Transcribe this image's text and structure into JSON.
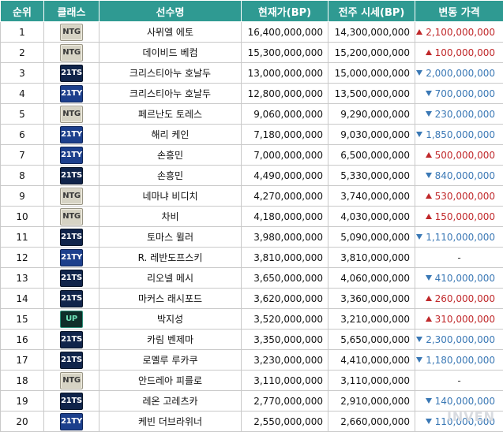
{
  "columns": [
    "순위",
    "클래스",
    "선수명",
    "현재가(BP)",
    "전주 시세(BP)",
    "변동 가격"
  ],
  "rows": [
    {
      "rank": "1",
      "class": "NTG",
      "name": "사뮈엘 에토",
      "current": "16,400,000,000",
      "prev": "14,300,000,000",
      "change": "2,100,000,000",
      "dir": "up"
    },
    {
      "rank": "2",
      "class": "NTG",
      "name": "데이비드 베컴",
      "current": "15,300,000,000",
      "prev": "15,200,000,000",
      "change": "100,000,000",
      "dir": "up"
    },
    {
      "rank": "3",
      "class": "21TS",
      "name": "크리스티아누 호날두",
      "current": "13,000,000,000",
      "prev": "15,000,000,000",
      "change": "2,000,000,000",
      "dir": "down"
    },
    {
      "rank": "4",
      "class": "21TY",
      "name": "크리스티아누 호날두",
      "current": "12,800,000,000",
      "prev": "13,500,000,000",
      "change": "700,000,000",
      "dir": "down"
    },
    {
      "rank": "5",
      "class": "NTG",
      "name": "페르난도 토레스",
      "current": "9,060,000,000",
      "prev": "9,290,000,000",
      "change": "230,000,000",
      "dir": "down"
    },
    {
      "rank": "6",
      "class": "21TY",
      "name": "해리 케인",
      "current": "7,180,000,000",
      "prev": "9,030,000,000",
      "change": "1,850,000,000",
      "dir": "down"
    },
    {
      "rank": "7",
      "class": "21TY",
      "name": "손흥민",
      "current": "7,000,000,000",
      "prev": "6,500,000,000",
      "change": "500,000,000",
      "dir": "up"
    },
    {
      "rank": "8",
      "class": "21TS",
      "name": "손흥민",
      "current": "4,490,000,000",
      "prev": "5,330,000,000",
      "change": "840,000,000",
      "dir": "down"
    },
    {
      "rank": "9",
      "class": "NTG",
      "name": "네마냐 비디치",
      "current": "4,270,000,000",
      "prev": "3,740,000,000",
      "change": "530,000,000",
      "dir": "up"
    },
    {
      "rank": "10",
      "class": "NTG",
      "name": "차비",
      "current": "4,180,000,000",
      "prev": "4,030,000,000",
      "change": "150,000,000",
      "dir": "up"
    },
    {
      "rank": "11",
      "class": "21TS",
      "name": "토마스 뮐러",
      "current": "3,980,000,000",
      "prev": "5,090,000,000",
      "change": "1,110,000,000",
      "dir": "down"
    },
    {
      "rank": "12",
      "class": "21TY",
      "name": "R. 레반도프스키",
      "current": "3,810,000,000",
      "prev": "3,810,000,000",
      "change": "-",
      "dir": "flat"
    },
    {
      "rank": "13",
      "class": "21TS",
      "name": "리오넬 메시",
      "current": "3,650,000,000",
      "prev": "4,060,000,000",
      "change": "410,000,000",
      "dir": "down"
    },
    {
      "rank": "14",
      "class": "21TS",
      "name": "마커스 래시포드",
      "current": "3,620,000,000",
      "prev": "3,360,000,000",
      "change": "260,000,000",
      "dir": "up"
    },
    {
      "rank": "15",
      "class": "UP",
      "name": "박지성",
      "current": "3,520,000,000",
      "prev": "3,210,000,000",
      "change": "310,000,000",
      "dir": "up"
    },
    {
      "rank": "16",
      "class": "21TS",
      "name": "카림 벤제마",
      "current": "3,350,000,000",
      "prev": "5,650,000,000",
      "change": "2,300,000,000",
      "dir": "down"
    },
    {
      "rank": "17",
      "class": "21TS",
      "name": "로멜루 루카쿠",
      "current": "3,230,000,000",
      "prev": "4,410,000,000",
      "change": "1,180,000,000",
      "dir": "down"
    },
    {
      "rank": "18",
      "class": "NTG",
      "name": "안드레아 피를로",
      "current": "3,110,000,000",
      "prev": "3,110,000,000",
      "change": "-",
      "dir": "flat"
    },
    {
      "rank": "19",
      "class": "21TS",
      "name": "레온 고레츠카",
      "current": "2,770,000,000",
      "prev": "2,910,000,000",
      "change": "140,000,000",
      "dir": "down"
    },
    {
      "rank": "20",
      "class": "21TY",
      "name": "케빈 더브라위너",
      "current": "2,550,000,000",
      "prev": "2,660,000,000",
      "change": "110,000,000",
      "dir": "down"
    }
  ],
  "watermark": "INVEN",
  "colors": {
    "header_bg": "#2f9a92",
    "up": "#c0282a",
    "down": "#3a78b5"
  }
}
